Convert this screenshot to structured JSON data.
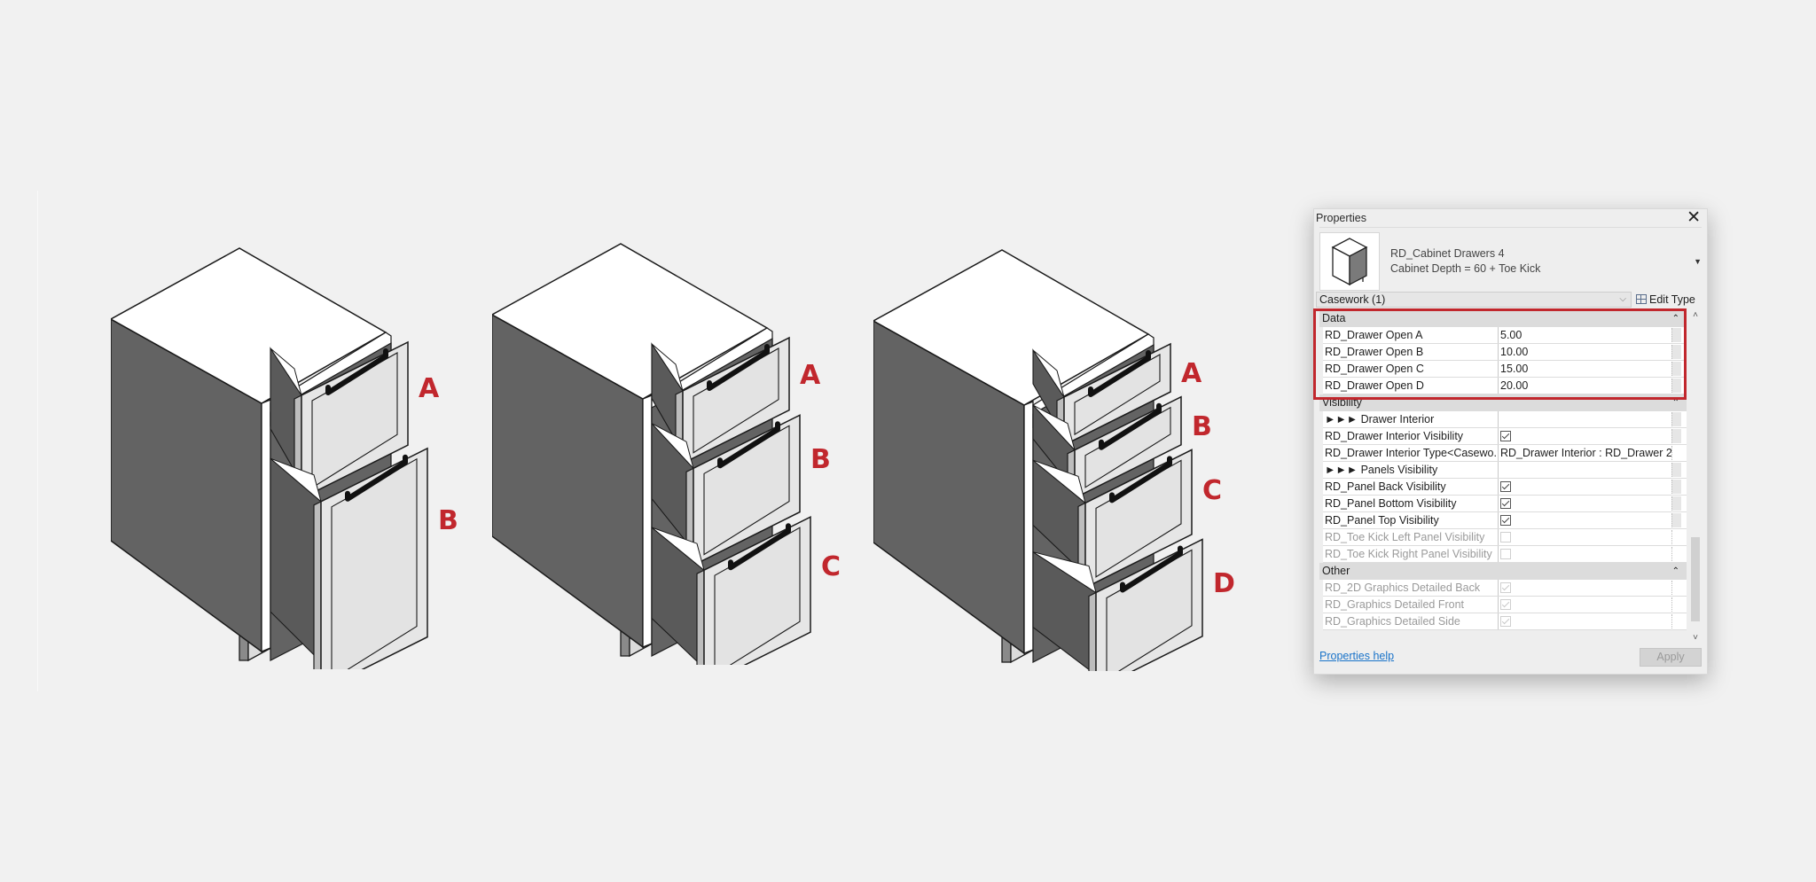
{
  "illustrations": [
    {
      "id": "cabinet-2-drawers",
      "labels": [
        "A",
        "B"
      ]
    },
    {
      "id": "cabinet-3-drawers",
      "labels": [
        "A",
        "B",
        "C"
      ]
    },
    {
      "id": "cabinet-4-drawers",
      "labels": [
        "A",
        "B",
        "C",
        "D"
      ]
    }
  ],
  "colors": {
    "background": "#f1f1f1",
    "callout": "#c1272d",
    "highlight": "#c1272d",
    "cabinet_side": "#636363",
    "cabinet_top": "#ffffff",
    "drawer_face": "#e6e6e6",
    "handle": "#111111",
    "link": "#1a73c9"
  },
  "properties_panel": {
    "title": "Properties",
    "close_icon": "close-icon",
    "type_selector": {
      "family_name": "RD_Cabinet Drawers 4",
      "type_name": "Cabinet Depth = 60 + Toe Kick",
      "dropdown_icon": "triangle-down-icon"
    },
    "category": {
      "value": "Casework (1)",
      "dropdown_icon": "chevron-down-icon"
    },
    "edit_type": {
      "label": "Edit Type",
      "icon": "edit-type-icon"
    },
    "groups": [
      {
        "name": "Data",
        "collapse_icon": "double-chevron-up-icon",
        "rows": [
          {
            "name": "RD_Drawer Open A",
            "value": "5.00",
            "type": "text"
          },
          {
            "name": "RD_Drawer Open B",
            "value": "10.00",
            "type": "text"
          },
          {
            "name": "RD_Drawer Open C",
            "value": "15.00",
            "type": "text"
          },
          {
            "name": "RD_Drawer Open D",
            "value": "20.00",
            "type": "text"
          }
        ]
      },
      {
        "name": "Visibility",
        "collapse_icon": "double-chevron-up-icon",
        "rows": [
          {
            "name": "►►► Drawer Interior",
            "value": "",
            "type": "text"
          },
          {
            "name": "RD_Drawer Interior Visibility",
            "checked": true,
            "type": "checkbox"
          },
          {
            "name": "RD_Drawer Interior Type<Casewo...",
            "value": "RD_Drawer Interior : RD_Drawer 2",
            "type": "text",
            "noButton": true
          },
          {
            "name": "►►► Panels Visibility",
            "value": "",
            "type": "text"
          },
          {
            "name": "RD_Panel Back Visibility",
            "checked": true,
            "type": "checkbox"
          },
          {
            "name": "RD_Panel Bottom Visibility",
            "checked": true,
            "type": "checkbox"
          },
          {
            "name": "RD_Panel Top Visibility",
            "checked": true,
            "type": "checkbox"
          },
          {
            "name": "RD_Toe Kick Left Panel Visibility",
            "checked": false,
            "type": "checkbox",
            "disabled": true,
            "noButton": true
          },
          {
            "name": "RD_Toe Kick Right Panel Visibility",
            "checked": false,
            "type": "checkbox",
            "disabled": true,
            "noButton": true
          }
        ]
      },
      {
        "name": "Other",
        "collapse_icon": "double-chevron-up-icon",
        "rows": [
          {
            "name": "RD_2D Graphics Detailed Back",
            "checked": true,
            "type": "checkbox",
            "disabled": true,
            "noButton": true
          },
          {
            "name": "RD_Graphics Detailed Front",
            "checked": true,
            "type": "checkbox",
            "disabled": true,
            "noButton": true
          },
          {
            "name": "RD_Graphics Detailed Side",
            "checked": true,
            "type": "checkbox",
            "disabled": true,
            "noButton": true
          }
        ]
      }
    ],
    "help_link": "Properties help",
    "apply_label": "Apply",
    "apply_enabled": false
  }
}
